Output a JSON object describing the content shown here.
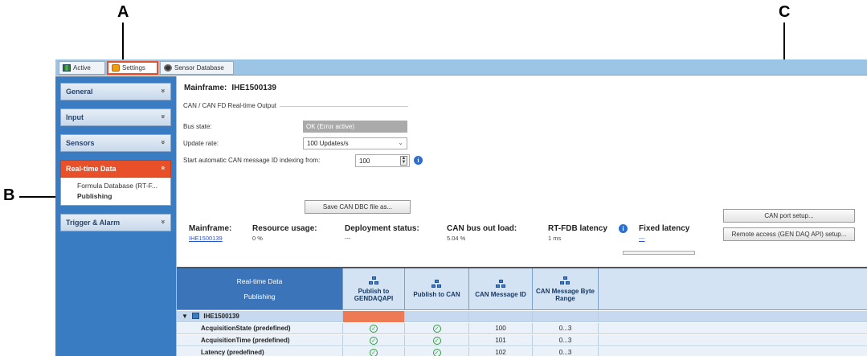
{
  "callouts": {
    "a": "A",
    "b": "B",
    "c": "C"
  },
  "tabs": [
    {
      "label": "Active",
      "icon": "grid-icon"
    },
    {
      "label": "Settings",
      "icon": "settings-icon"
    },
    {
      "label": "Sensor Database",
      "icon": "sensor-icon"
    }
  ],
  "sidebar": {
    "groups": [
      {
        "label": "General"
      },
      {
        "label": "Input"
      },
      {
        "label": "Sensors"
      },
      {
        "label": "Real-time Data"
      },
      {
        "label": "Trigger & Alarm"
      }
    ],
    "subitems": [
      {
        "label": "Formula Database (RT-F..."
      },
      {
        "label": "Publishing"
      }
    ],
    "chevron_down": "»",
    "chevron_up": "«"
  },
  "main": {
    "mainframe_label": "Mainframe:",
    "mainframe_id": "IHE1500139",
    "group_title": "CAN / CAN FD Real-time Output",
    "bus_state_label": "Bus state:",
    "bus_state_value": "OK (Error active)",
    "update_rate_label": "Update rate:",
    "update_rate_value": "100 Updates/s",
    "indexing_label": "Start automatic CAN message ID indexing from:",
    "indexing_value": "100",
    "save_dbc_button": "Save CAN DBC file as...",
    "can_port_button": "CAN port setup...",
    "remote_access_button": "Remote access (GEN DAQ API) setup..."
  },
  "stats": {
    "mainframe_label": "Mainframe:",
    "mainframe_value": "IHE1500139",
    "resource_label": "Resource usage:",
    "resource_value": "0 %",
    "deployment_label": "Deployment status:",
    "deployment_value": "---",
    "can_bus_label": "CAN bus out load:",
    "can_bus_value": "5.04 %",
    "rtfdb_label": "RT-FDB latency",
    "rtfdb_value": "1 ms",
    "fixed_label": "Fixed latency",
    "fixed_value": "---"
  },
  "grid": {
    "header_line1": "Real-time Data",
    "header_line2": "Publishing",
    "columns": [
      {
        "label": "Publish to GENDAQAPI"
      },
      {
        "label": "Publish to CAN"
      },
      {
        "label": "CAN Message ID"
      },
      {
        "label": "CAN Message Byte Range"
      }
    ],
    "group_row": "IHE1500139",
    "rows": [
      {
        "name": "AcquisitionState (predefined)",
        "gendaq": true,
        "can": true,
        "id": "100",
        "range": "0...3"
      },
      {
        "name": "AcquisitionTime (predefined)",
        "gendaq": true,
        "can": true,
        "id": "101",
        "range": "0...3"
      },
      {
        "name": "Latency (predefined)",
        "gendaq": true,
        "can": true,
        "id": "102",
        "range": "0...3"
      }
    ],
    "check_glyph": "✓"
  },
  "colors": {
    "accent": "#e8502a",
    "sidebar": "#3a7cc1",
    "tabbar": "#9cc4e4",
    "header_blue": "#3b74b8"
  }
}
